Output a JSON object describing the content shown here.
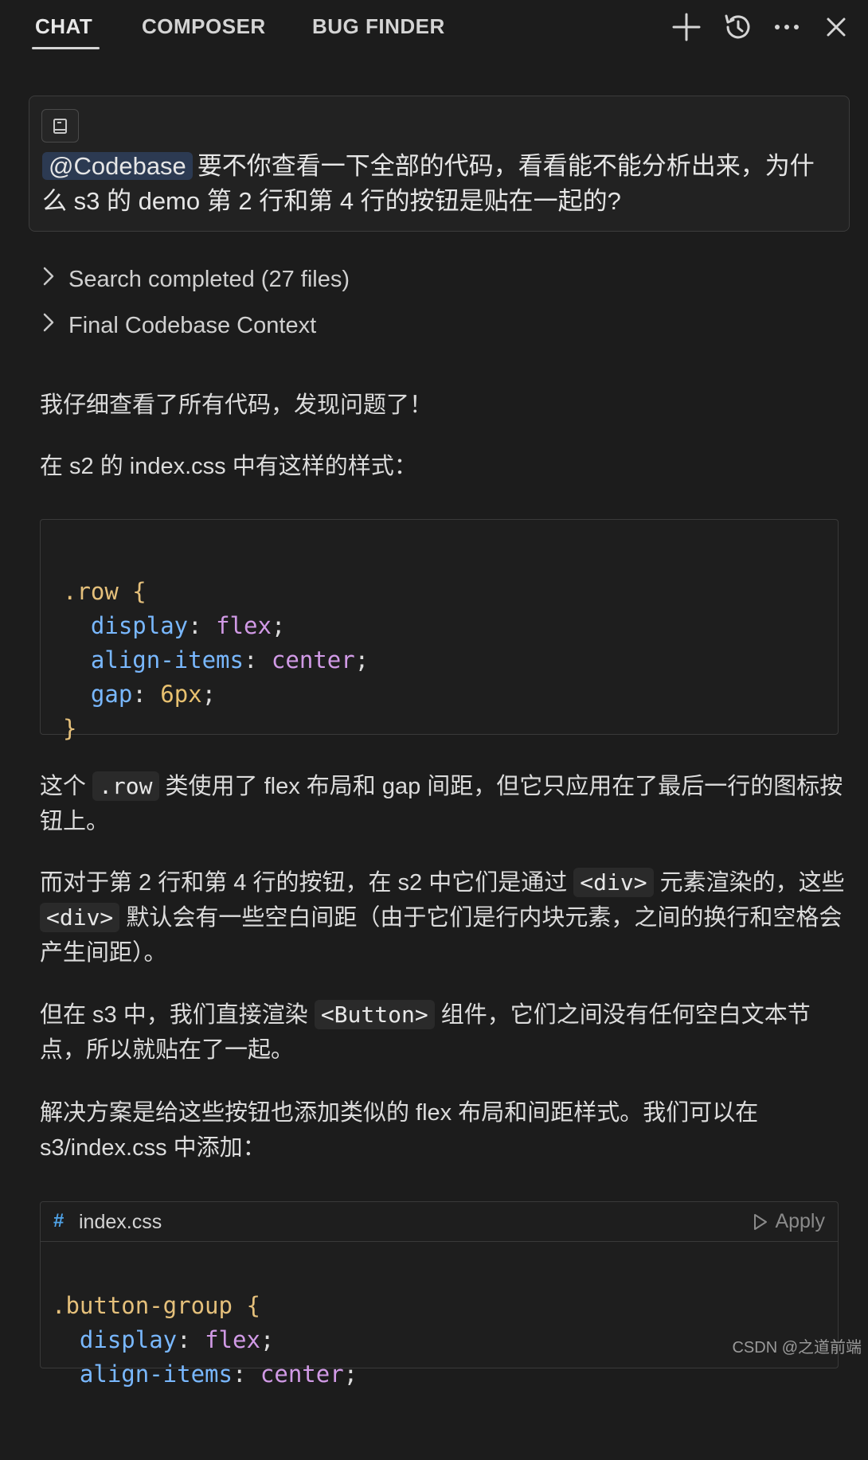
{
  "header": {
    "tabs": [
      {
        "label": "CHAT",
        "active": true
      },
      {
        "label": "COMPOSER",
        "active": false
      },
      {
        "label": "BUG FINDER",
        "active": false
      }
    ],
    "actions": [
      "plus-icon",
      "history-icon",
      "more-icon",
      "close-icon"
    ]
  },
  "user_message": {
    "mention": "@Codebase",
    "text": "要不你查看一下全部的代码，看看能不能分析出来，为什么 s3 的 demo 第 2 行和第 4 行的按钮是贴在一起的?"
  },
  "steps": [
    {
      "label": "Search completed (27 files)"
    },
    {
      "label": "Final Codebase Context"
    }
  ],
  "answer": {
    "p1": "我仔细查看了所有代码，发现问题了！",
    "p2": "在 s2 的 index.css 中有这样的样式：",
    "p3_a": "这个 ",
    "p3_code": ".row",
    "p3_b": " 类使用了 flex 布局和 gap 间距，但它只应用在了最后一行的图标按钮上。",
    "p4_a": "而对于第 2 行和第 4 行的按钮，在 s2 中它们是通过 ",
    "p4_code1": "<div>",
    "p4_b": " 元素渲染的，这些 ",
    "p4_code2": "<div>",
    "p4_c": " 默认会有一些空白间距（由于它们是行内块元素，之间的换行和空格会产生间距）。",
    "p5_a": "但在 s3 中，我们直接渲染 ",
    "p5_code": "<Button>",
    "p5_b": " 组件，它们之间没有任何空白文本节点，所以就贴在了一起。",
    "p6": "解决方案是给这些按钮也添加类似的 flex 布局和间距样式。我们可以在 s3/index.css 中添加："
  },
  "code1": {
    "selector": ".row",
    "open": " {",
    "close": "}",
    "decls": [
      {
        "prop": "display",
        "value": "flex"
      },
      {
        "prop": "align-items",
        "value": "center"
      },
      {
        "prop": "gap",
        "value": "6px"
      }
    ]
  },
  "code2": {
    "hash": "#",
    "filename": "index.css",
    "apply_label": "Apply",
    "selector": ".button-group",
    "open": " {",
    "decls": [
      {
        "prop": "display",
        "value": "flex"
      },
      {
        "prop": "align-items",
        "value": "center"
      }
    ]
  },
  "watermark": "CSDN @之道前端"
}
